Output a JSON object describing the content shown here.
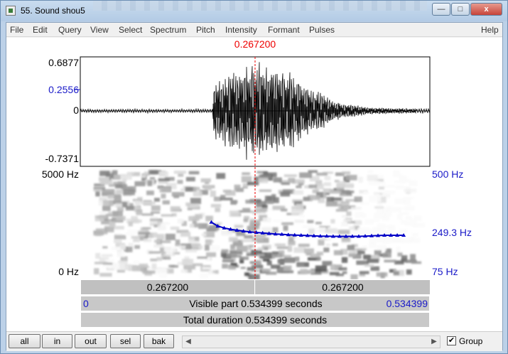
{
  "window": {
    "title": "55. Sound shou5",
    "min_label": "—",
    "max_label": "□",
    "close_label": "x"
  },
  "menu": {
    "items": [
      "File",
      "Edit",
      "Query",
      "View",
      "Select",
      "Spectrum",
      "Pitch",
      "Intensity",
      "Formant",
      "Pulses"
    ],
    "help": "Help"
  },
  "cursor": {
    "time": "0.267200",
    "time_fraction": 0.5
  },
  "waveform": {
    "max": "0.6877",
    "cursor_value": "0.2556",
    "zero": "0",
    "min": "-0.7371"
  },
  "spectrogram": {
    "max_freq": "5000 Hz",
    "min_freq": "0 Hz",
    "pitch_top": "500 Hz",
    "pitch_value": "249.3 Hz",
    "pitch_bottom": "75 Hz"
  },
  "pitch_track": {
    "t_start": 0.375,
    "t_end": 0.925,
    "hz": [
      290,
      275,
      268,
      263,
      259,
      256,
      253,
      251,
      249,
      247,
      245,
      244,
      242,
      241,
      240,
      239,
      238,
      237,
      237,
      236,
      236,
      236,
      236,
      236,
      237,
      238,
      239,
      240,
      240,
      240,
      240
    ],
    "hz_min": 75,
    "hz_max": 500,
    "color": "#0000c8"
  },
  "time_bars": {
    "left_time": "0.267200",
    "right_time": "0.267200",
    "visible_start": "0",
    "visible_label": "Visible part 0.534399 seconds",
    "visible_end": "0.534399",
    "total_label": "Total duration 0.534399 seconds"
  },
  "buttons": {
    "all": "all",
    "in": "in",
    "out": "out",
    "sel": "sel",
    "bak": "bak"
  },
  "scroll": {
    "left": "◀",
    "right": "▶"
  },
  "group": {
    "checked": "✔",
    "label": "Group"
  }
}
